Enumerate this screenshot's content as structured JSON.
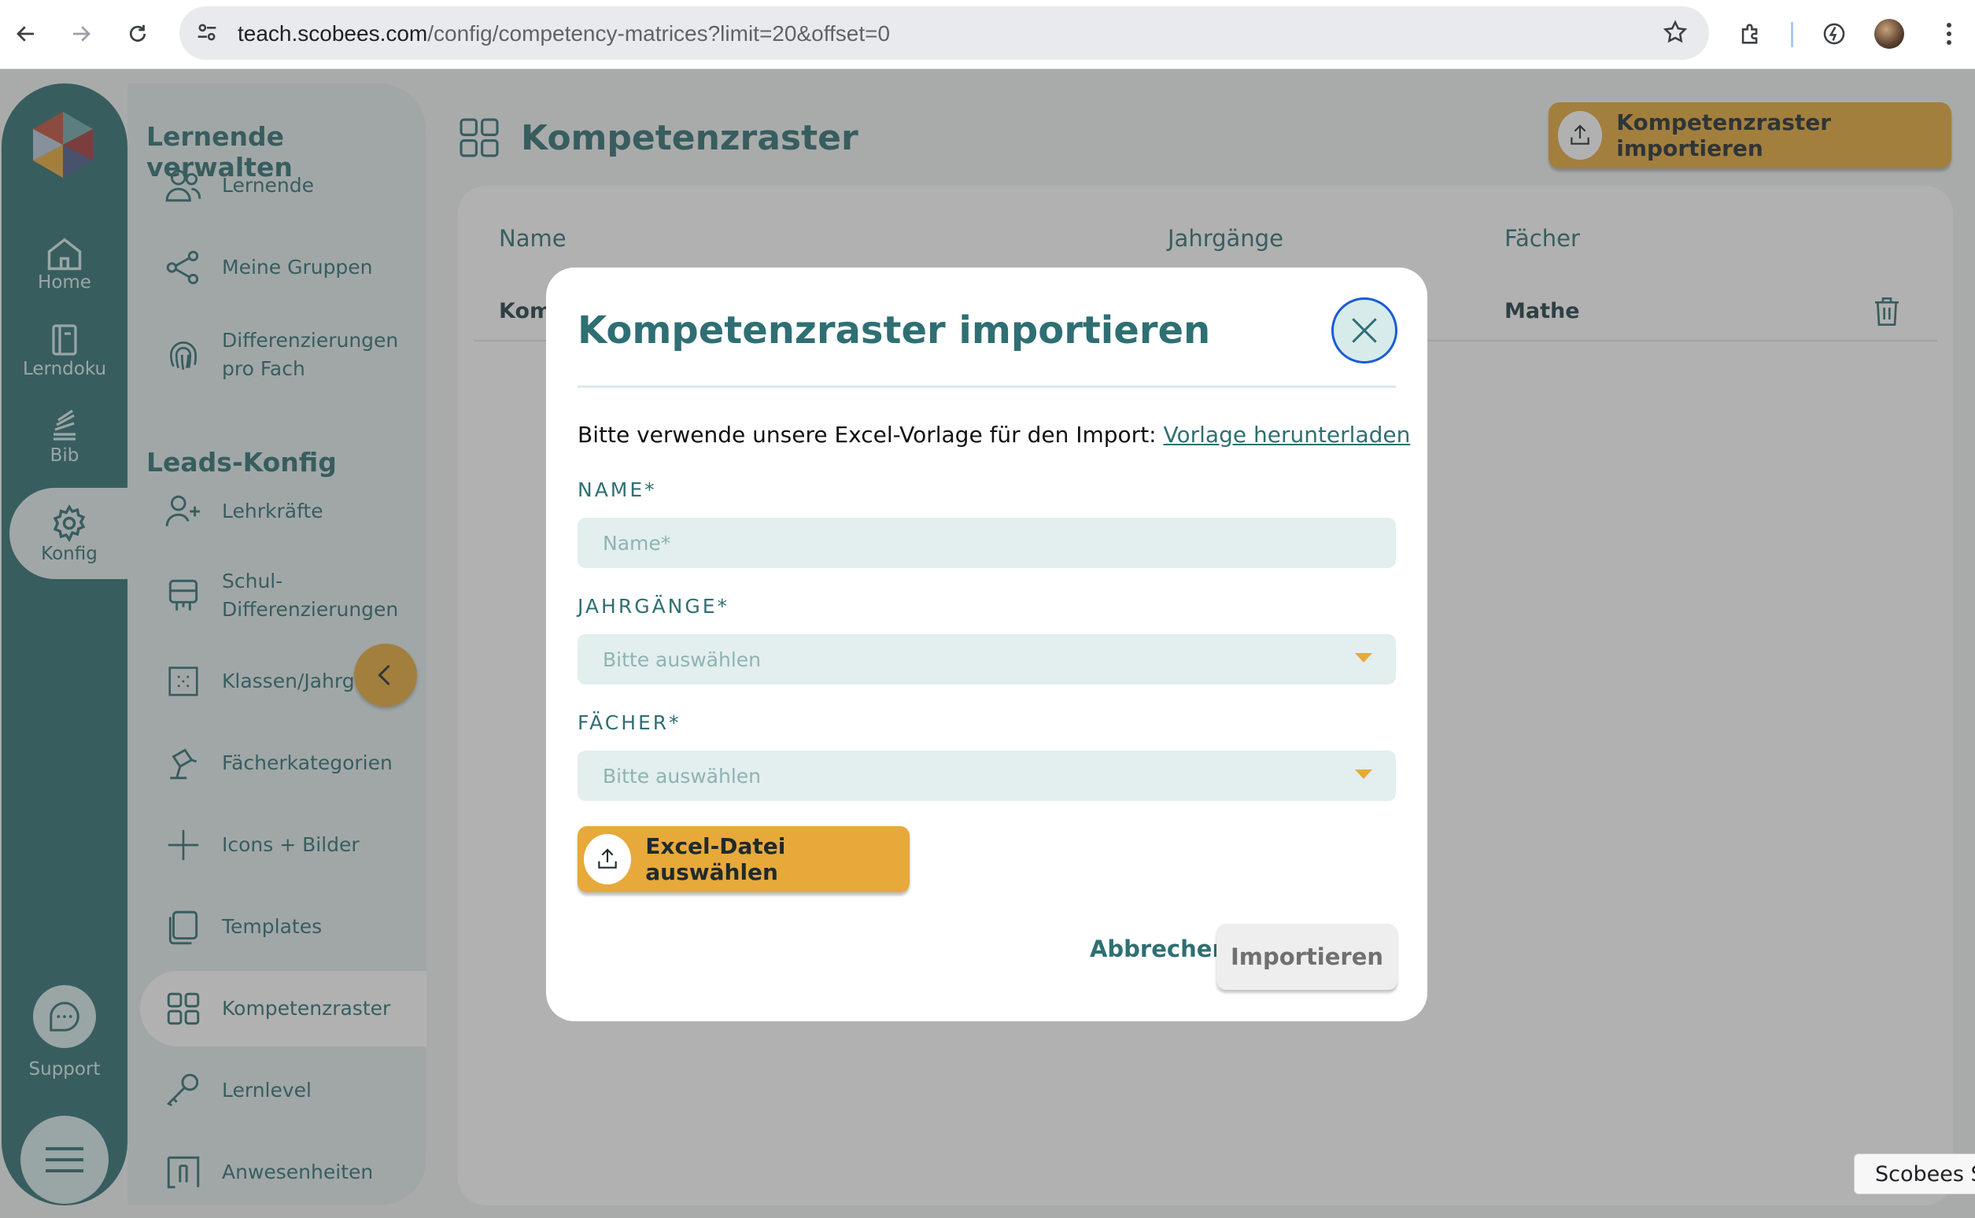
{
  "browser": {
    "url_domain": "teach.scobees.com",
    "url_path": "/config/competency-matrices?limit=20&offset=0"
  },
  "rail": {
    "items": [
      {
        "label": "Home",
        "icon": "home-icon"
      },
      {
        "label": "Lerndoku",
        "icon": "notebook-icon"
      },
      {
        "label": "Bib",
        "icon": "books-icon"
      },
      {
        "label": "Konfig",
        "icon": "gear-icon"
      }
    ],
    "support_label": "Support"
  },
  "subnav": {
    "section1_title": "Lernende verwalten",
    "section2_title": "Leads-Konfig",
    "items": [
      {
        "label": "Lernende",
        "icon": "users-icon"
      },
      {
        "label": "Meine Gruppen",
        "icon": "share-icon"
      },
      {
        "label": "Differenzierungen pro Fach",
        "icon": "fingerprint-icon"
      },
      {
        "label": "Lehrkräfte",
        "icon": "add-user-icon"
      },
      {
        "label": "Schul-Differenzierungen",
        "icon": "board-icon"
      },
      {
        "label": "Klassen/Jahrgä",
        "icon": "grid-dots-icon"
      },
      {
        "label": "Fächerkategorien",
        "icon": "lamp-icon"
      },
      {
        "label": "Icons + Bilder",
        "icon": "plus-icon"
      },
      {
        "label": "Templates",
        "icon": "copy-icon"
      },
      {
        "label": "Kompetenzraster",
        "icon": "grid-icon"
      },
      {
        "label": "Lernlevel",
        "icon": "key-icon"
      },
      {
        "label": "Anwesenheiten",
        "icon": "door-icon"
      }
    ]
  },
  "page": {
    "title": "Kompetenzraster",
    "import_button": "Kompetenzraster importieren",
    "table": {
      "headers": [
        "Name",
        "Jahrgänge",
        "Fächer"
      ],
      "row": {
        "name": "Kom",
        "subjects": "Mathe"
      }
    }
  },
  "modal": {
    "title": "Kompetenzraster importieren",
    "hint_text": "Bitte verwende unsere Excel-Vorlage für den Import:",
    "hint_link": "Vorlage herunterladen",
    "name_label": "NAME*",
    "name_placeholder": "Name*",
    "grades_label": "JAHRGÄNGE*",
    "grades_placeholder": "Bitte auswählen",
    "subjects_label": "FÄCHER*",
    "subjects_placeholder": "Bitte auswählen",
    "file_button": "Excel-Datei auswählen",
    "cancel_button": "Abbrechen",
    "import_button": "Importieren"
  },
  "tooltip": "Scobees S",
  "colors": {
    "teal": "#2f6f73",
    "accent": "#e7a93a",
    "focus": "#1a5bd6"
  }
}
